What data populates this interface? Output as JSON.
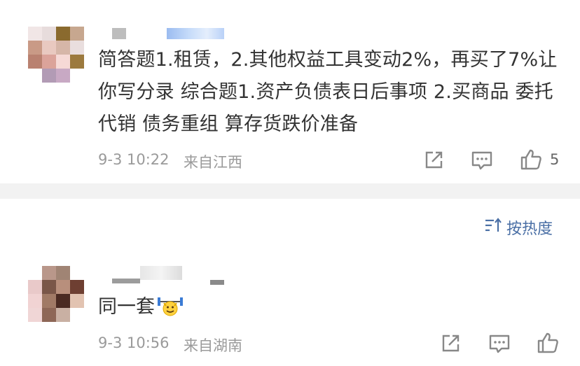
{
  "comments": [
    {
      "text": "简答题1.租赁，2.其他权益工具变动2%，再买了7%让你写分录 综合题1.资产负债表日后事项 2.买商品 委托代销 债务重组 算存货跌价准备",
      "timestamp": "9-3 10:22",
      "location": "来自江西",
      "like_count": "5"
    }
  ],
  "sort_label": "按热度",
  "replies": [
    {
      "text": "同一套",
      "emoji": "weightlifting-emoji",
      "timestamp": "9-3 10:56",
      "location": "来自湖南"
    }
  ],
  "icons": {
    "share": "share-icon",
    "comment": "comment-icon",
    "like": "thumbs-up-icon",
    "sort": "sort-icon"
  },
  "colors": {
    "link": "#4a6fa5",
    "meta": "#9a9a9a",
    "divider": "#f2f2f2"
  }
}
